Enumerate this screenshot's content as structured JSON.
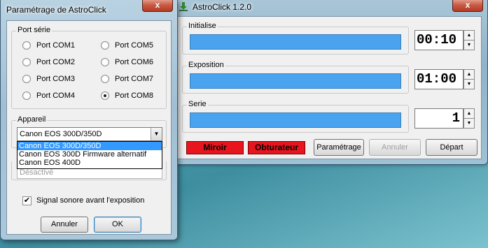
{
  "main_window": {
    "title": "AstroClick 1.2.0",
    "close_glyph": "x",
    "groups": {
      "initialise": {
        "label": "Initialise",
        "time": "00:10"
      },
      "exposition": {
        "label": "Exposition",
        "time": "01:00"
      },
      "serie": {
        "label": "Serie",
        "count": "1"
      }
    },
    "status": {
      "miroir": "Miroir",
      "obturateur": "Obturateur"
    },
    "buttons": {
      "parametrage": "Paramétrage",
      "annuler": "Annuler",
      "depart": "Départ"
    },
    "colors": {
      "bar": "#4aa3ef",
      "status_red": "#e8141e"
    }
  },
  "dialog": {
    "title": "Paramétrage de  AstroClick",
    "close_glyph": "x",
    "port_group": {
      "label": "Port série",
      "ports": [
        {
          "label": "Port  COM1",
          "checked": false
        },
        {
          "label": "Port  COM5",
          "checked": false
        },
        {
          "label": "Port  COM2",
          "checked": false
        },
        {
          "label": "Port  COM6",
          "checked": false
        },
        {
          "label": "Port  COM3",
          "checked": false
        },
        {
          "label": "Port  COM7",
          "checked": false
        },
        {
          "label": "Port  COM4",
          "checked": false
        },
        {
          "label": "Port  COM8",
          "checked": true
        }
      ]
    },
    "appareil_group": {
      "label": "Appareil",
      "selected": "Canon EOS 300D/350D",
      "options": [
        "Canon EOS 300D/350D",
        "Canon EOS 300D Firmware alternatif",
        "Canon EOS 400D"
      ]
    },
    "hidden_combo_value": "Désactivé",
    "signal_checkbox": {
      "label": "Signal sonore avant l'exposition",
      "checked": true,
      "mark": "✔"
    },
    "buttons": {
      "annuler": "Annuler",
      "ok": "OK"
    }
  }
}
